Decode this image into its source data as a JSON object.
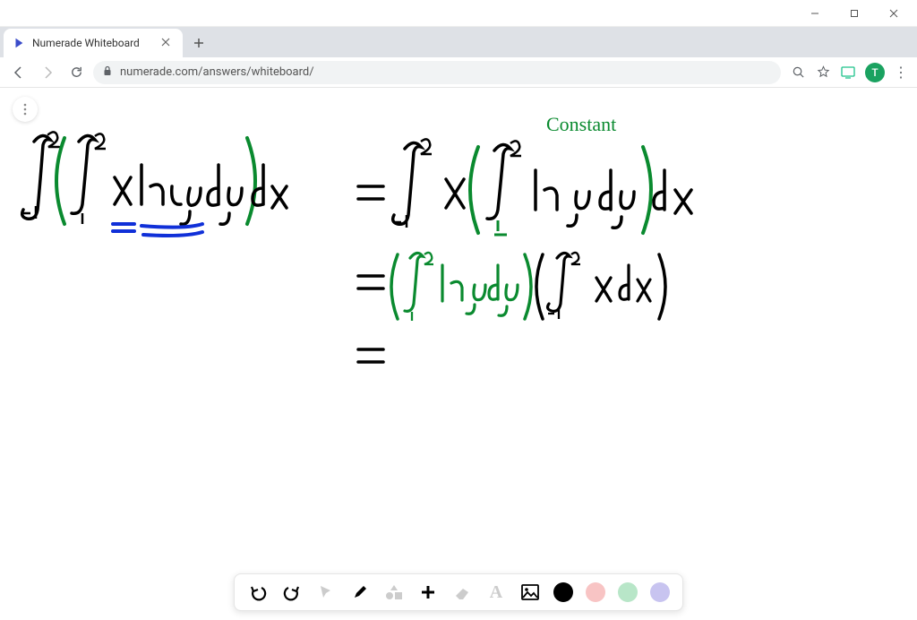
{
  "window": {
    "minimize_aria": "Minimize",
    "maximize_aria": "Maximize",
    "close_aria": "Close"
  },
  "tab": {
    "title": "Numerade Whiteboard",
    "close_aria": "Close tab"
  },
  "newtab_aria": "New tab",
  "nav": {
    "back_aria": "Back",
    "forward_aria": "Forward",
    "reload_aria": "Reload"
  },
  "omnibox": {
    "lock_aria": "Secure",
    "url": "numerade.com/answers/whiteboard/"
  },
  "chrome_right": {
    "zoom_aria": "Zoom",
    "bookmark_aria": "Bookmark",
    "cast_aria": "Cast",
    "avatar_letter": "T",
    "menu_aria": "More"
  },
  "page_menu_aria": "Menu",
  "handwriting": {
    "line1_left": "∫₋₁² ( ∫₁² x ln y  dy ) dx",
    "line1_right_annotation": "Constant",
    "line1_right": "= ∫₋₁²  x ( ∫₁²  ln y  dy ) dx",
    "line2": "= ( ∫₁²  ln y dy ) ( ∫₋₁²  x dx )",
    "line3": "="
  },
  "toolbar": {
    "undo_aria": "Undo",
    "redo_aria": "Redo",
    "pointer_aria": "Select",
    "pen_aria": "Pen",
    "shapes_aria": "Shapes",
    "add_aria": "Add",
    "eraser_aria": "Eraser",
    "text_aria": "Text",
    "image_aria": "Image",
    "color_black": "Black",
    "color_red": "Red",
    "color_green": "Green",
    "color_purple": "Purple"
  }
}
